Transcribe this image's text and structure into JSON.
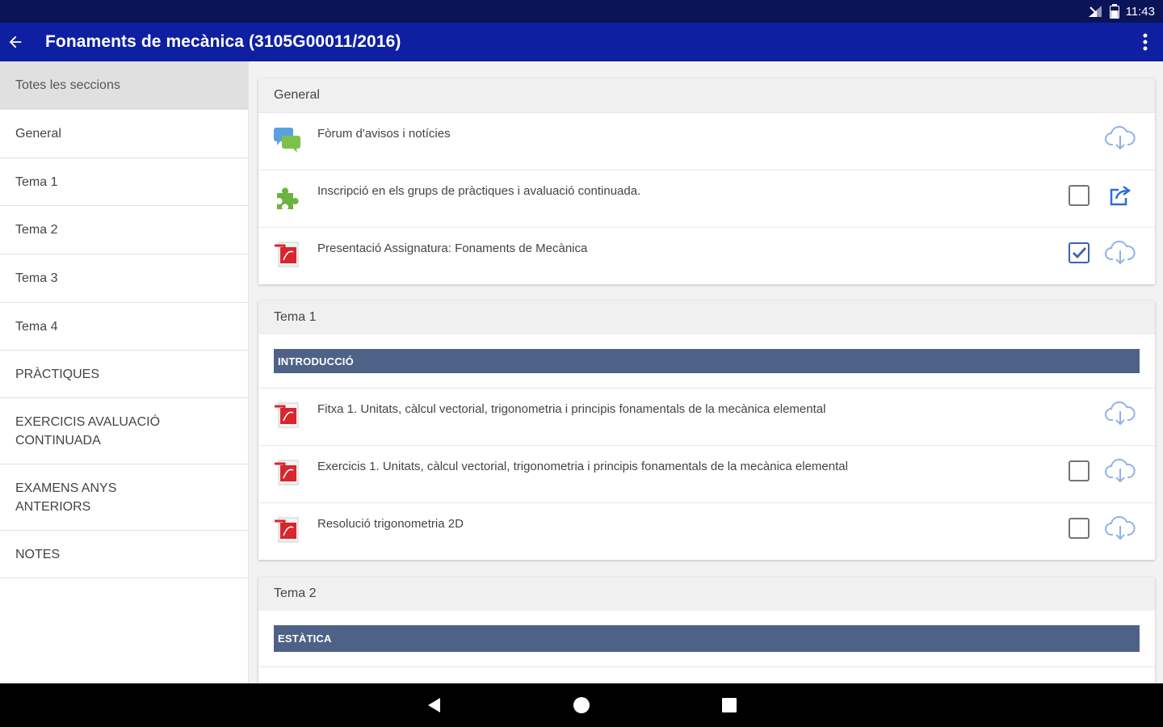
{
  "status_bar": {
    "time": "11:43"
  },
  "app_bar": {
    "title": "Fonaments de mecànica (3105G00011/2016)"
  },
  "sidebar": {
    "items": [
      {
        "label": "Totes les seccions",
        "active": true
      },
      {
        "label": "General"
      },
      {
        "label": "Tema 1"
      },
      {
        "label": "Tema 2"
      },
      {
        "label": "Tema 3"
      },
      {
        "label": "Tema 4"
      },
      {
        "label": "PRÀCTIQUES"
      },
      {
        "label": "EXERCICIS AVALUACIÓ CONTINUADA"
      },
      {
        "label": "EXAMENS ANYS ANTERIORS"
      },
      {
        "label": "NOTES"
      }
    ]
  },
  "sections": [
    {
      "title": "General",
      "items": [
        {
          "icon": "forum-icon",
          "text": "Fòrum d'avisos i notícies",
          "checkbox": null,
          "action": "cloud-download-icon"
        },
        {
          "icon": "puzzle-icon",
          "text": "Inscripció en els grups de pràctiques i avaluació continuada.",
          "checkbox": "unchecked",
          "action": "open-external-icon"
        },
        {
          "icon": "pdf-icon",
          "text": "Presentació Assignatura: Fonaments de Mecànica",
          "checkbox": "checked",
          "action": "cloud-download-icon"
        }
      ]
    },
    {
      "title": "Tema 1",
      "label": "INTRODUCCIÓ",
      "items": [
        {
          "icon": "pdf-icon",
          "text": "Fitxa 1. Unitats, càlcul vectorial, trigonometria i principis fonamentals de la mecànica elemental",
          "checkbox": null,
          "action": "cloud-download-icon"
        },
        {
          "icon": "pdf-icon",
          "text": "Exercicis 1. Unitats, càlcul vectorial, trigonometria i principis fonamentals de la mecànica elemental",
          "checkbox": "unchecked",
          "action": "cloud-download-icon"
        },
        {
          "icon": "pdf-icon",
          "text": "Resolució trigonometria 2D",
          "checkbox": "unchecked",
          "action": "cloud-download-icon"
        }
      ]
    },
    {
      "title": "Tema 2",
      "label": "ESTÀTICA"
    }
  ],
  "colors": {
    "status_bar": "#0a1457",
    "app_bar": "#0e1fa1",
    "label_band": "#4e6287",
    "download_icon": "#8fb3e6",
    "check_accent": "#3a63b4"
  }
}
